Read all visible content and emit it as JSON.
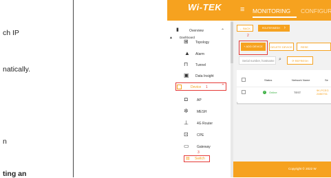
{
  "document": {
    "lines": [
      {
        "text": "ch IP",
        "bold": false
      },
      {
        "text": "natically.",
        "bold": false
      },
      {
        "text": "n",
        "bold": false
      },
      {
        "text": "ting an",
        "bold": true
      }
    ]
  },
  "app": {
    "logo": "Wi-TEK",
    "nav": {
      "monitoring": "MONITORING",
      "configuration": "CONFIGURATIO"
    },
    "colors": {
      "accent": "#f6a21f",
      "highlight": "#e53935",
      "online": "#3cb043"
    },
    "sidebar": {
      "dashboard": "Dashboard",
      "overview": "Overview",
      "items": [
        {
          "label": "Topology",
          "icon": "topology-icon"
        },
        {
          "label": "Alarm",
          "icon": "alarm-icon"
        },
        {
          "label": "Tunnel",
          "icon": "tunnel-icon"
        },
        {
          "label": "Data Insight",
          "icon": "data-insight-icon"
        }
      ],
      "device": {
        "label": "Device",
        "step": "1"
      },
      "device_items": [
        {
          "label": "AP",
          "icon": "ap-icon"
        },
        {
          "label": "MESH",
          "icon": "mesh-icon"
        },
        {
          "label": "4G Router",
          "icon": "router-icon"
        },
        {
          "label": "CPE",
          "icon": "cpe-icon"
        },
        {
          "label": "Gateway",
          "icon": "gateway-icon"
        }
      ],
      "gateway_step": "3",
      "switch": "Switch"
    },
    "content": {
      "back": "← BACK",
      "active_tab": "ROUTER/MESH",
      "step2": "2",
      "add_device": "+ ADD DEVICE",
      "delete_device": "DELETE DEVICE",
      "reset": "RESE",
      "search_placeholder": "Serial number, hostname",
      "refresh": "REFRESH",
      "table": {
        "headers": [
          "Status",
          "Network Name",
          "Se"
        ],
        "rows": [
          {
            "status": "Online",
            "network": "TEST",
            "serial_line1": "9K-PCEG",
            "serial_line2": "24B0701"
          }
        ]
      }
    },
    "footer": "Copyright © 2022 W"
  }
}
